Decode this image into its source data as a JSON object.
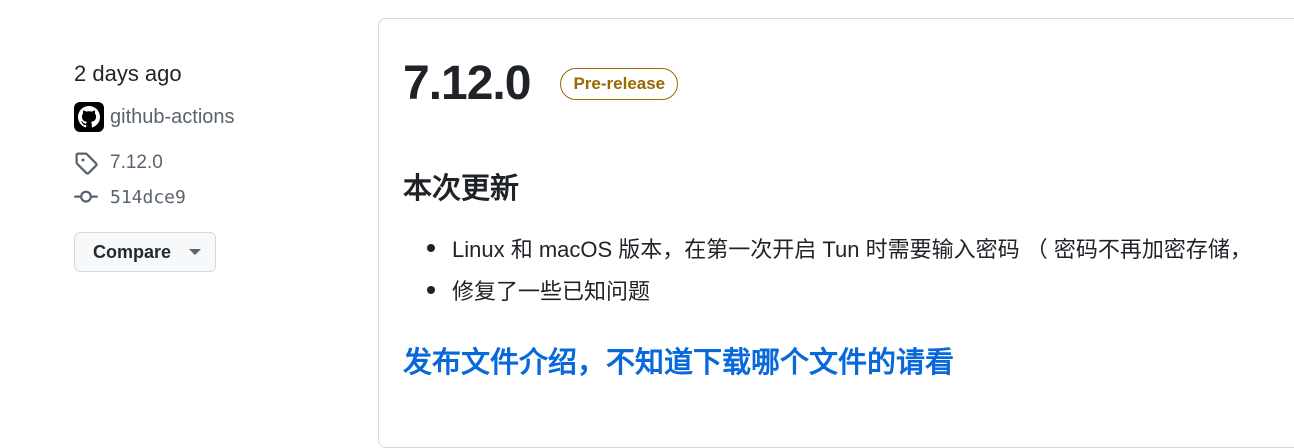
{
  "meta": {
    "date": "2 days ago",
    "author": "github-actions",
    "tag": "7.12.0",
    "commit": "514dce9",
    "compare_label": "Compare"
  },
  "release": {
    "title": "7.12.0",
    "badge": "Pre-release",
    "section_heading": "本次更新",
    "notes": [
      "Linux 和 macOS 版本，在第一次开启 Tun 时需要输入密码 （ 密码不再加密存储，",
      "修复了一些已知问题"
    ],
    "link_heading": "发布文件介绍，不知道下载哪个文件的请看"
  },
  "icons": {
    "avatar": "github-octocat-icon",
    "tag": "tag-icon",
    "commit": "git-commit-icon",
    "dropdown": "triangle-down-icon"
  },
  "colors": {
    "text": "#1f2328",
    "muted": "#59636e",
    "border": "#d1d9e0",
    "prerelease": "#9a6700",
    "link": "#0969da"
  }
}
